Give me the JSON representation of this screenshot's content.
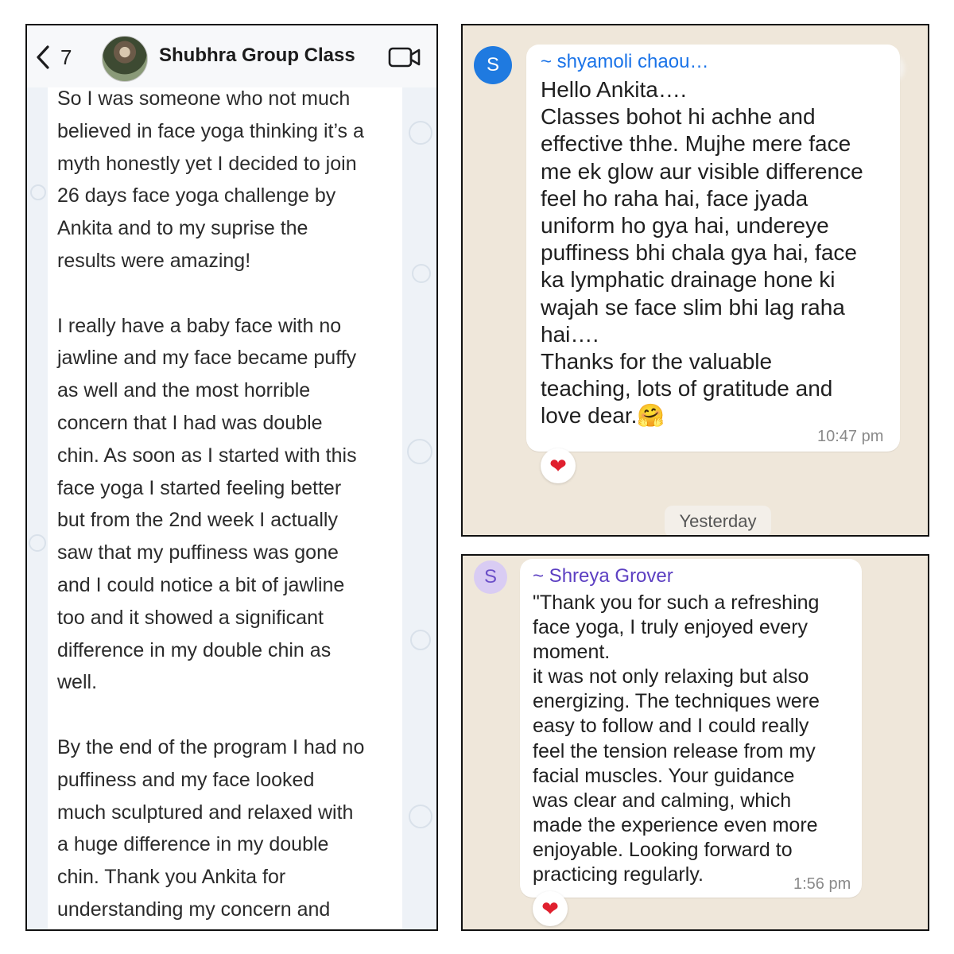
{
  "left_chat": {
    "back_count": "7",
    "group_title": "Shubhra Group Class",
    "message_lines": [
      "So I was someone who not much",
      "believed in face yoga thinking it’s a",
      "myth honestly yet I decided to join",
      "26 days face yoga challenge by",
      "Ankita and to my suprise the",
      "results were amazing!",
      "",
      "I really have a baby face with no",
      "jawline and my face became puffy",
      "as well and the most horrible",
      "concern that I had was double",
      "chin. As soon as I started with this",
      "face yoga I started feeling better",
      "but from the 2nd week I actually",
      "saw that my puffiness was gone",
      "and I could notice a bit of jawline",
      "too and it showed a significant",
      "difference in my double chin as",
      "well.",
      "",
      "By the end of the program I had no",
      "puffiness and my face looked",
      "much sculptured and relaxed with",
      "a huge difference in my double",
      "chin. Thank you Ankita for",
      "understanding my concern and"
    ]
  },
  "top_right_chat": {
    "avatar_letter": "S",
    "sender": "~ shyamoli chaou…",
    "message_lines": [
      "Hello Ankita….",
      "Classes bohot hi achhe and",
      "effective thhe. Mujhe mere face",
      "me ek glow aur visible difference",
      "feel ho raha hai, face jyada",
      "uniform ho gya hai, undereye",
      "puffiness bhi chala gya hai, face",
      "ka lymphatic drainage hone ki",
      "wajah se face slim bhi lag raha",
      "hai….",
      "Thanks for the valuable",
      "teaching, lots of gratitude and",
      "love dear.🤗"
    ],
    "time": "10:47 pm",
    "reaction": "❤",
    "date_divider": "Yesterday",
    "colors": {
      "avatar": "#1f7ae0",
      "sender": "#1a73e8"
    }
  },
  "bottom_right_chat": {
    "avatar_letter": "S",
    "sender": "~ Shreya Grover",
    "message_lines": [
      "\"Thank you for such a refreshing",
      "face yoga, I truly enjoyed every",
      "moment.",
      " it was not only relaxing but also",
      "energizing. The techniques were",
      "easy to follow and I could really",
      "feel the tension release from my",
      "facial muscles. Your guidance",
      "was clear and calming, which",
      "made the experience even more",
      "enjoyable. Looking forward to",
      "practicing regularly."
    ],
    "time": "1:56 pm",
    "reaction": "❤",
    "colors": {
      "avatar_bg": "#d9ccf3",
      "avatar_fg": "#6b4fc8",
      "sender": "#5c3fc2"
    }
  }
}
